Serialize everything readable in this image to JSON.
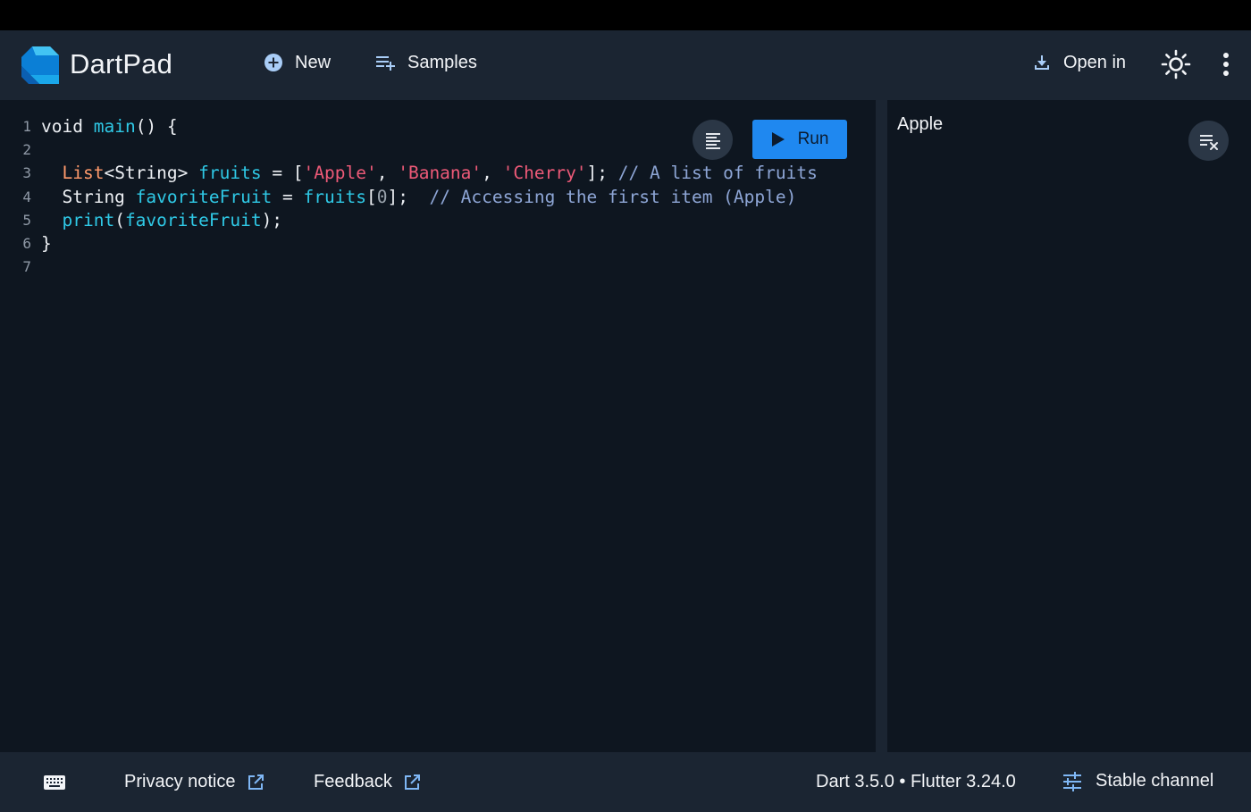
{
  "header": {
    "brand": "DartPad",
    "new_label": "New",
    "samples_label": "Samples",
    "open_in_label": "Open in"
  },
  "editor": {
    "run_label": "Run",
    "lines": [
      {
        "n": "1"
      },
      {
        "n": "2"
      },
      {
        "n": "3"
      },
      {
        "n": "4"
      },
      {
        "n": "5"
      },
      {
        "n": "6"
      },
      {
        "n": "7"
      }
    ],
    "code": {
      "l1_kw": "void",
      "l1_fn": "main",
      "l1_rest": "() {",
      "l3_type": "List",
      "l3_generic": "<String> ",
      "l3_var": "fruits",
      "l3_eq": " = [",
      "l3_s1": "'Apple'",
      "l3_c1": ", ",
      "l3_s2": "'Banana'",
      "l3_c2": ", ",
      "l3_s3": "'Cherry'",
      "l3_end": "]; ",
      "l3_comment": "// A list of fruits",
      "l4_type": "String ",
      "l4_var": "favoriteFruit",
      "l4_eq": " = ",
      "l4_ref": "fruits",
      "l4_ob": "[",
      "l4_num": "0",
      "l4_cb": "];  ",
      "l4_comment": "// Accessing the first item (Apple)",
      "l5_fn": "print",
      "l5_op": "(",
      "l5_arg": "favoriteFruit",
      "l5_cl": ");",
      "l6": "}"
    }
  },
  "output": {
    "text": "Apple"
  },
  "footer": {
    "privacy": "Privacy notice",
    "feedback": "Feedback",
    "version": "Dart 3.5.0 • Flutter 3.24.0",
    "channel": "Stable channel"
  },
  "colors": {
    "appbar": "#1b2532",
    "editor_bg": "#0e1620",
    "accent": "#1f88f0",
    "icon_blue": "#7fb7f5"
  },
  "icons": {
    "logo": "dart-logo",
    "new": "add-circle-icon",
    "samples": "playlist-add-icon",
    "open_in": "download-icon",
    "theme": "sun-icon",
    "menu": "more-vert-icon",
    "format": "format-align-icon",
    "run": "play-icon",
    "clear": "clear-output-icon",
    "keyboard": "keyboard-icon",
    "external": "external-link-icon",
    "channel": "tune-icon"
  }
}
